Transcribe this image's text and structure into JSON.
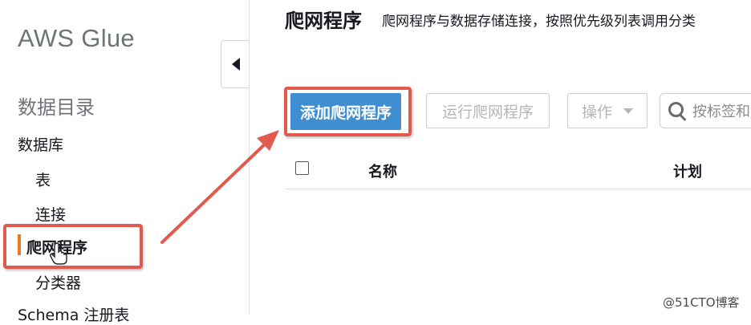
{
  "sidebar": {
    "brand": "AWS Glue",
    "section_title": "数据目录",
    "items": [
      {
        "label": "数据库"
      },
      {
        "label": "表"
      },
      {
        "label": "连接"
      },
      {
        "label": "爬网程序",
        "active": true
      },
      {
        "label": "分类器"
      },
      {
        "label": "Schema 注册表"
      }
    ]
  },
  "main": {
    "title": "爬网程序",
    "description": "爬网程序与数据存储连接，按照优先级列表调用分类",
    "toolbar": {
      "add_label": "添加爬网程序",
      "run_label": "运行爬网程序",
      "action_label": "操作",
      "search_placeholder": "按标签和"
    },
    "table": {
      "columns": [
        "名称",
        "计划"
      ]
    }
  },
  "watermark": "@51CTO博客",
  "colors": {
    "primary_button": "#3f8ed1",
    "highlight": "#e25a4e",
    "active_marker": "#e37c2b"
  }
}
